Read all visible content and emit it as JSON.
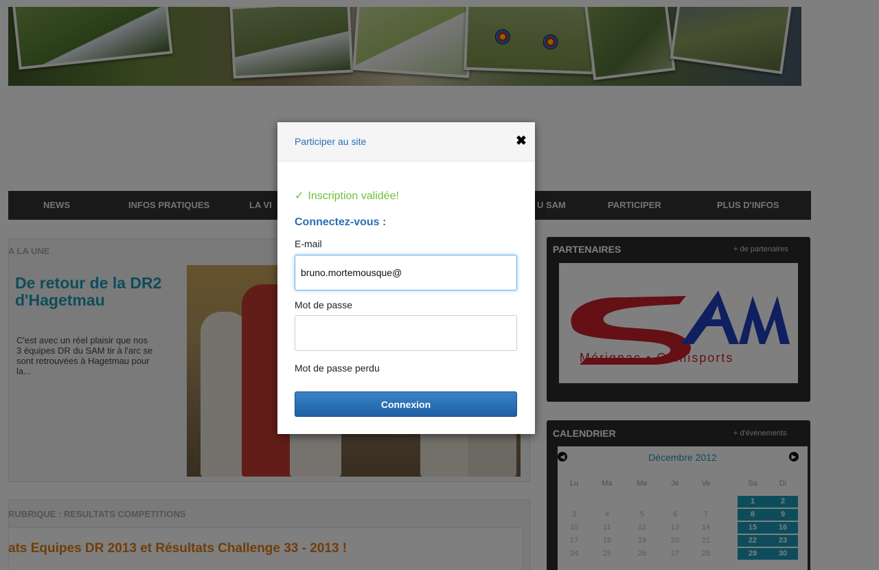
{
  "nav": {
    "items": [
      "NEWS",
      "INFOS PRATIQUES",
      "LA VI",
      "U SAM",
      "PARTICIPER",
      "PLUS D'INFOS"
    ]
  },
  "a_la_une": {
    "label": "A LA UNE",
    "title": "De retour de la DR2 d'Hagetmau",
    "excerpt": "C'est avec un réel plaisir que nos 3 équipes DR du SAM tir à l'arc se sont retrouvées à Hagetmau pour la..."
  },
  "rubrique": {
    "label": "RUBRIQUE : RESULTATS COMPETITIONS",
    "article_title": "ats Equipes DR 2013 et Résultats Challenge 33 - 2013 !"
  },
  "partenaires": {
    "label": "PARTENAIRES",
    "more": "+ de partenaires",
    "logo_main": "SAM",
    "logo_sub": "Mérignac • Omnisports"
  },
  "calendrier": {
    "label": "CALENDRIER",
    "more": "+ d'événements",
    "month": "Décembre 2012",
    "prev_icon": "chevron-left-icon",
    "next_icon": "chevron-right-icon",
    "weekdays": [
      "Lu",
      "Ma",
      "Me",
      "Je",
      "Ve",
      "Sa",
      "Di"
    ],
    "weeks": [
      [
        "",
        "",
        "",
        "",
        "",
        "1",
        "2"
      ],
      [
        "3",
        "4",
        "5",
        "6",
        "7",
        "8",
        "9"
      ],
      [
        "10",
        "11",
        "12",
        "13",
        "14",
        "15",
        "16"
      ],
      [
        "17",
        "18",
        "19",
        "20",
        "21",
        "22",
        "23"
      ],
      [
        "24",
        "25",
        "26",
        "27",
        "28",
        "29",
        "30"
      ]
    ],
    "highlight_color": "#1a9bb7"
  },
  "modal": {
    "title": "Participer au site",
    "close_icon": "close-icon",
    "success_icon": "checkmark-icon",
    "success_message": "Inscription validée!",
    "heading": "Connectez-vous :",
    "email_label": "E-mail",
    "email_value": "bruno.mortemousque@",
    "password_label": "Mot de passe",
    "password_value": "",
    "lost_password": "Mot de passe perdu",
    "submit": "Connexion",
    "accent_color": "#2a6fb5",
    "success_color": "#6cc13a"
  }
}
